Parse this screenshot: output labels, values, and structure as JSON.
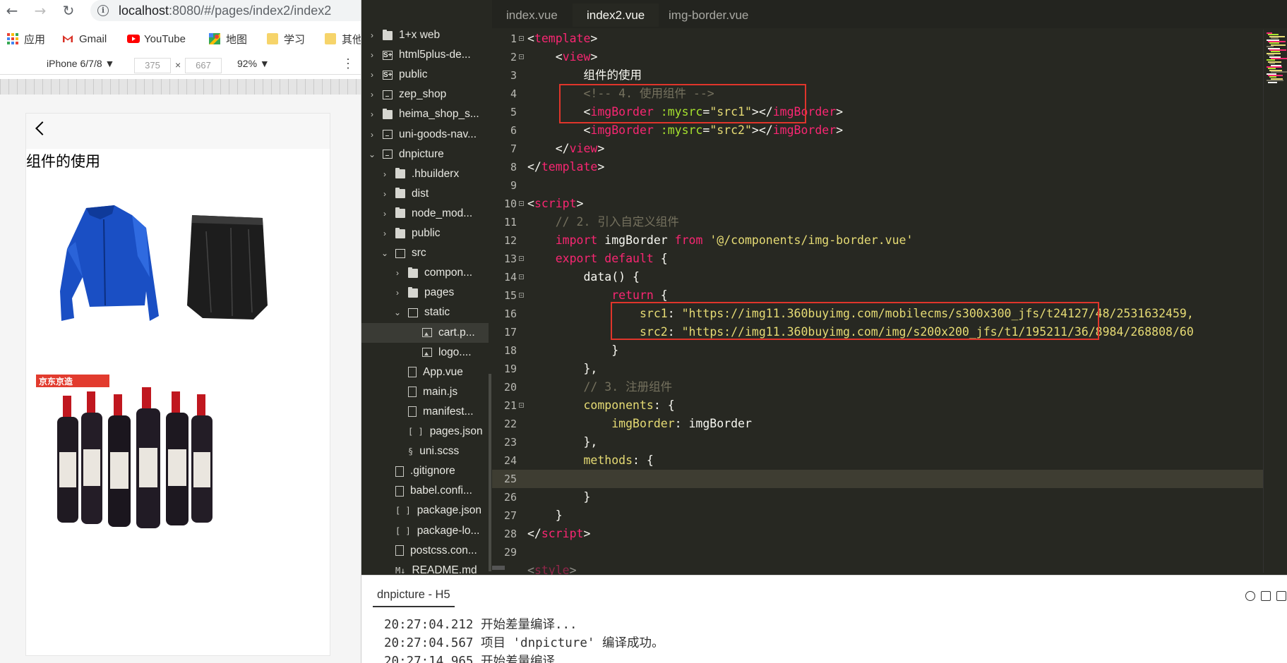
{
  "browser": {
    "url_host": "localhost",
    "url_path": ":8080/#/pages/index2/index2",
    "bookmarks": [
      {
        "label": "应用",
        "icon": "apps-grid-icon"
      },
      {
        "label": "Gmail",
        "icon": "gmail-icon"
      },
      {
        "label": "YouTube",
        "icon": "youtube-icon"
      },
      {
        "label": "地图",
        "icon": "maps-icon"
      },
      {
        "label": "学习",
        "icon": "folder-icon"
      },
      {
        "label": "其他",
        "icon": "folder-icon"
      }
    ],
    "device": "iPhone 6/7/8 ▼",
    "width": "375",
    "times": "×",
    "height": "667",
    "zoom": "92% ▼",
    "more": "⋮"
  },
  "phone": {
    "title": "组件的使用"
  },
  "ide": {
    "explorer": [
      {
        "label": "1+x web",
        "level": 0,
        "arrow": "›",
        "icon": "folder"
      },
      {
        "label": "html5plus-de...",
        "level": 0,
        "arrow": "›",
        "icon": "s5"
      },
      {
        "label": "public",
        "level": 0,
        "arrow": "›",
        "icon": "s5"
      },
      {
        "label": "zep_shop",
        "level": 0,
        "arrow": "›",
        "icon": "proj"
      },
      {
        "label": "heima_shop_s...",
        "level": 0,
        "arrow": "›",
        "icon": "folder"
      },
      {
        "label": "uni-goods-nav...",
        "level": 0,
        "arrow": "›",
        "icon": "proj"
      },
      {
        "label": "dnpicture",
        "level": 0,
        "arrow": "⌄",
        "icon": "proj"
      },
      {
        "label": ".hbuilderx",
        "level": 1,
        "arrow": "›",
        "icon": "folder"
      },
      {
        "label": "dist",
        "level": 1,
        "arrow": "›",
        "icon": "folder"
      },
      {
        "label": "node_mod...",
        "level": 1,
        "arrow": "›",
        "icon": "folder"
      },
      {
        "label": "public",
        "level": 1,
        "arrow": "›",
        "icon": "folder"
      },
      {
        "label": "src",
        "level": 1,
        "arrow": "⌄",
        "icon": "folder-open"
      },
      {
        "label": "compon...",
        "level": 2,
        "arrow": "›",
        "icon": "folder"
      },
      {
        "label": "pages",
        "level": 2,
        "arrow": "›",
        "icon": "folder"
      },
      {
        "label": "static",
        "level": 2,
        "arrow": "⌄",
        "icon": "folder-open"
      },
      {
        "label": "cart.p...",
        "level": 3,
        "arrow": "",
        "icon": "img"
      },
      {
        "label": "logo....",
        "level": 3,
        "arrow": "",
        "icon": "img"
      },
      {
        "label": "App.vue",
        "level": 2,
        "arrow": "",
        "icon": "vue"
      },
      {
        "label": "main.js",
        "level": 2,
        "arrow": "",
        "icon": "file"
      },
      {
        "label": "manifest...",
        "level": 2,
        "arrow": "",
        "icon": "gear"
      },
      {
        "label": "pages.json",
        "level": 2,
        "arrow": "",
        "icon": "json"
      },
      {
        "label": "uni.scss",
        "level": 2,
        "arrow": "",
        "icon": "scss"
      },
      {
        "label": ".gitignore",
        "level": 1,
        "arrow": "",
        "icon": "file"
      },
      {
        "label": "babel.confi...",
        "level": 1,
        "arrow": "",
        "icon": "file"
      },
      {
        "label": "package.json",
        "level": 1,
        "arrow": "",
        "icon": "json"
      },
      {
        "label": "package-lo...",
        "level": 1,
        "arrow": "",
        "icon": "json"
      },
      {
        "label": "postcss.con...",
        "level": 1,
        "arrow": "",
        "icon": "file"
      },
      {
        "label": "README.md",
        "level": 1,
        "arrow": "",
        "icon": "md"
      }
    ],
    "tabs": [
      "index.vue",
      "index2.vue",
      "img-border.vue"
    ],
    "active_tab": "index2.vue",
    "console": {
      "title": "dnpicture - H5",
      "lines": [
        {
          "time": "20:27:04.212",
          "msg": " 开始差量编译..."
        },
        {
          "time": "20:27:04.567",
          "msg": " 项目 'dnpicture' 编译成功。"
        },
        {
          "time": "20:27:14.965",
          "msg": " 开始差量编译..."
        }
      ]
    }
  },
  "code": {
    "line_numbers": [
      "1",
      "2",
      "3",
      "4",
      "5",
      "6",
      "7",
      "8",
      "9",
      "10",
      "11",
      "12",
      "13",
      "14",
      "15",
      "16",
      "17",
      "18",
      "19",
      "20",
      "21",
      "22",
      "23",
      "24",
      "25",
      "26",
      "27",
      "28",
      "29"
    ],
    "l1_open": "<",
    "l1_tag": "template",
    "l1_close": ">",
    "l2_open": "<",
    "l2_tag": "view",
    "l2_close": ">",
    "l3_text": "组件的使用",
    "l4_comment": "<!-- 4. 使用组件 -->",
    "l5_lt": "<",
    "l5_tag": "imgBorder",
    "l5_attr": ":mysrc",
    "l5_eq": "=",
    "l5_val": "\"src1\"",
    "l5_mid": "></",
    "l5_tag2": "imgBorder",
    "l5_gt": ">",
    "l6_lt": "<",
    "l6_tag": "imgBorder",
    "l6_attr": ":mysrc",
    "l6_eq": "=",
    "l6_val": "\"src2\"",
    "l6_mid": "></",
    "l6_tag2": "imgBorder",
    "l6_gt": ">",
    "l7_open": "</",
    "l7_tag": "view",
    "l7_close": ">",
    "l8_open": "</",
    "l8_tag": "template",
    "l8_close": ">",
    "l10_open": "<",
    "l10_tag": "script",
    "l10_close": ">",
    "l11_comment": "// 2. 引入自定义组件",
    "l12_import": "import",
    "l12_name": "imgBorder",
    "l12_from": "from",
    "l12_path": "'@/components/img-border.vue'",
    "l13_export": "export",
    "l13_default": "default",
    "l13_brace": "{",
    "l14_data": "data() {",
    "l15_return": "return",
    "l15_brace": "{",
    "l16_key": "src1",
    "l16_colon": ":",
    "l16_val": "\"https://img11.360buyimg.com/mobilecms/s300x300_jfs/t24127/48/2531632459,",
    "l17_key": "src2",
    "l17_colon": ":",
    "l17_val": "\"https://img11.360buyimg.com/img/s200x200_jfs/t1/195211/36/8984/268808/60",
    "l18_text": "}",
    "l19_text": "},",
    "l20_comment": "// 3. 注册组件",
    "l21_key": "components",
    "l21_rest": ": {",
    "l22_key": "imgBorder",
    "l22_rest": ": imgBorder",
    "l23_text": "},",
    "l24_key": "methods",
    "l24_rest": ": {",
    "l26_text": "}",
    "l27_text": "}",
    "l28_open": "</",
    "l28_tag": "script",
    "l28_close": ">",
    "l30_open": "<",
    "l30_tag": "style",
    "l30_close": ">"
  },
  "colors": {
    "editor_bg": "#272822",
    "tag": "#f92672",
    "attr": "#a6e22e",
    "string": "#e6db74",
    "comment": "#75715e",
    "highlight_box": "#e0352b"
  }
}
